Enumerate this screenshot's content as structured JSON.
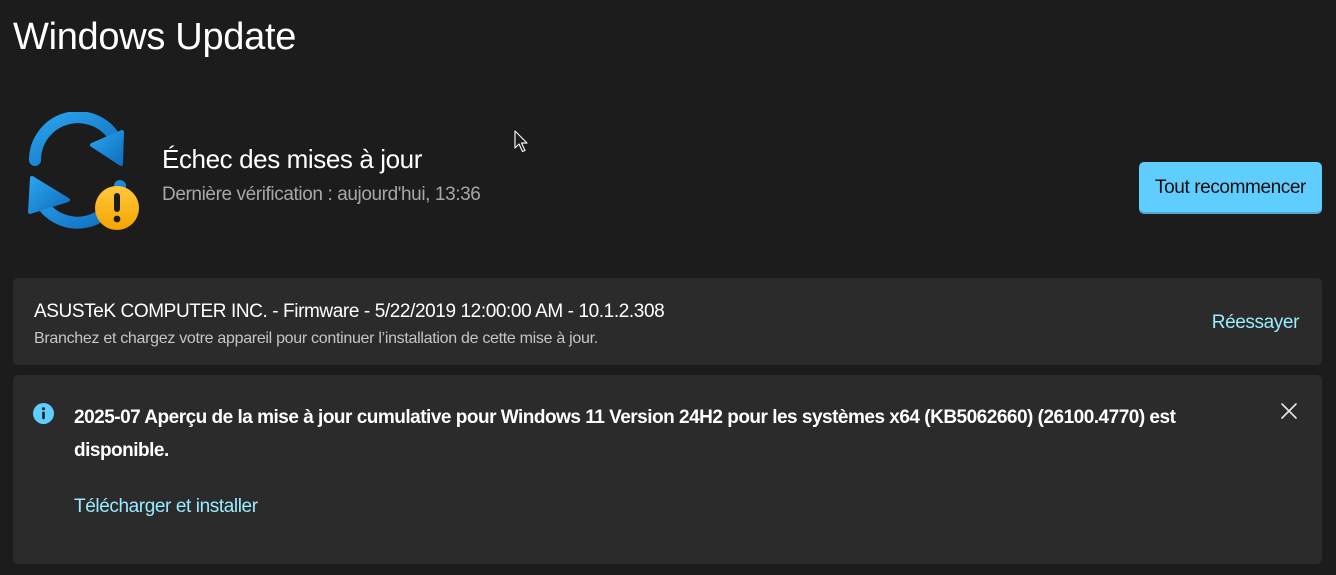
{
  "page": {
    "title": "Windows Update"
  },
  "status": {
    "icon": "sync-warning-icon",
    "title": "Échec des mises à jour",
    "last_check": "Dernière vérification : aujourd'hui, 13:36",
    "action_label": "Tout recommencer"
  },
  "firmware_update": {
    "title": "ASUSTeK COMPUTER INC. - Firmware - 5/22/2019 12:00:00 AM - 10.1.2.308",
    "message": "Branchez et chargez votre appareil pour continuer l’installation de cette mise à jour.",
    "action_label": "Réessayer"
  },
  "notification": {
    "icon": "info-icon",
    "text": "2025-07 Aperçu de la mise à jour cumulative pour Windows 11 Version 24H2 pour les systèmes x64 (KB5062660) (26100.4770) est disponible.",
    "action_label": "Télécharger et installer",
    "close_icon": "close-icon"
  },
  "colors": {
    "background": "#1c1c1c",
    "card": "#2b2b2b",
    "accent": "#60cdff",
    "link": "#99ebff",
    "warning": "#ffb900",
    "sync_blue": "#1a8ad4"
  }
}
